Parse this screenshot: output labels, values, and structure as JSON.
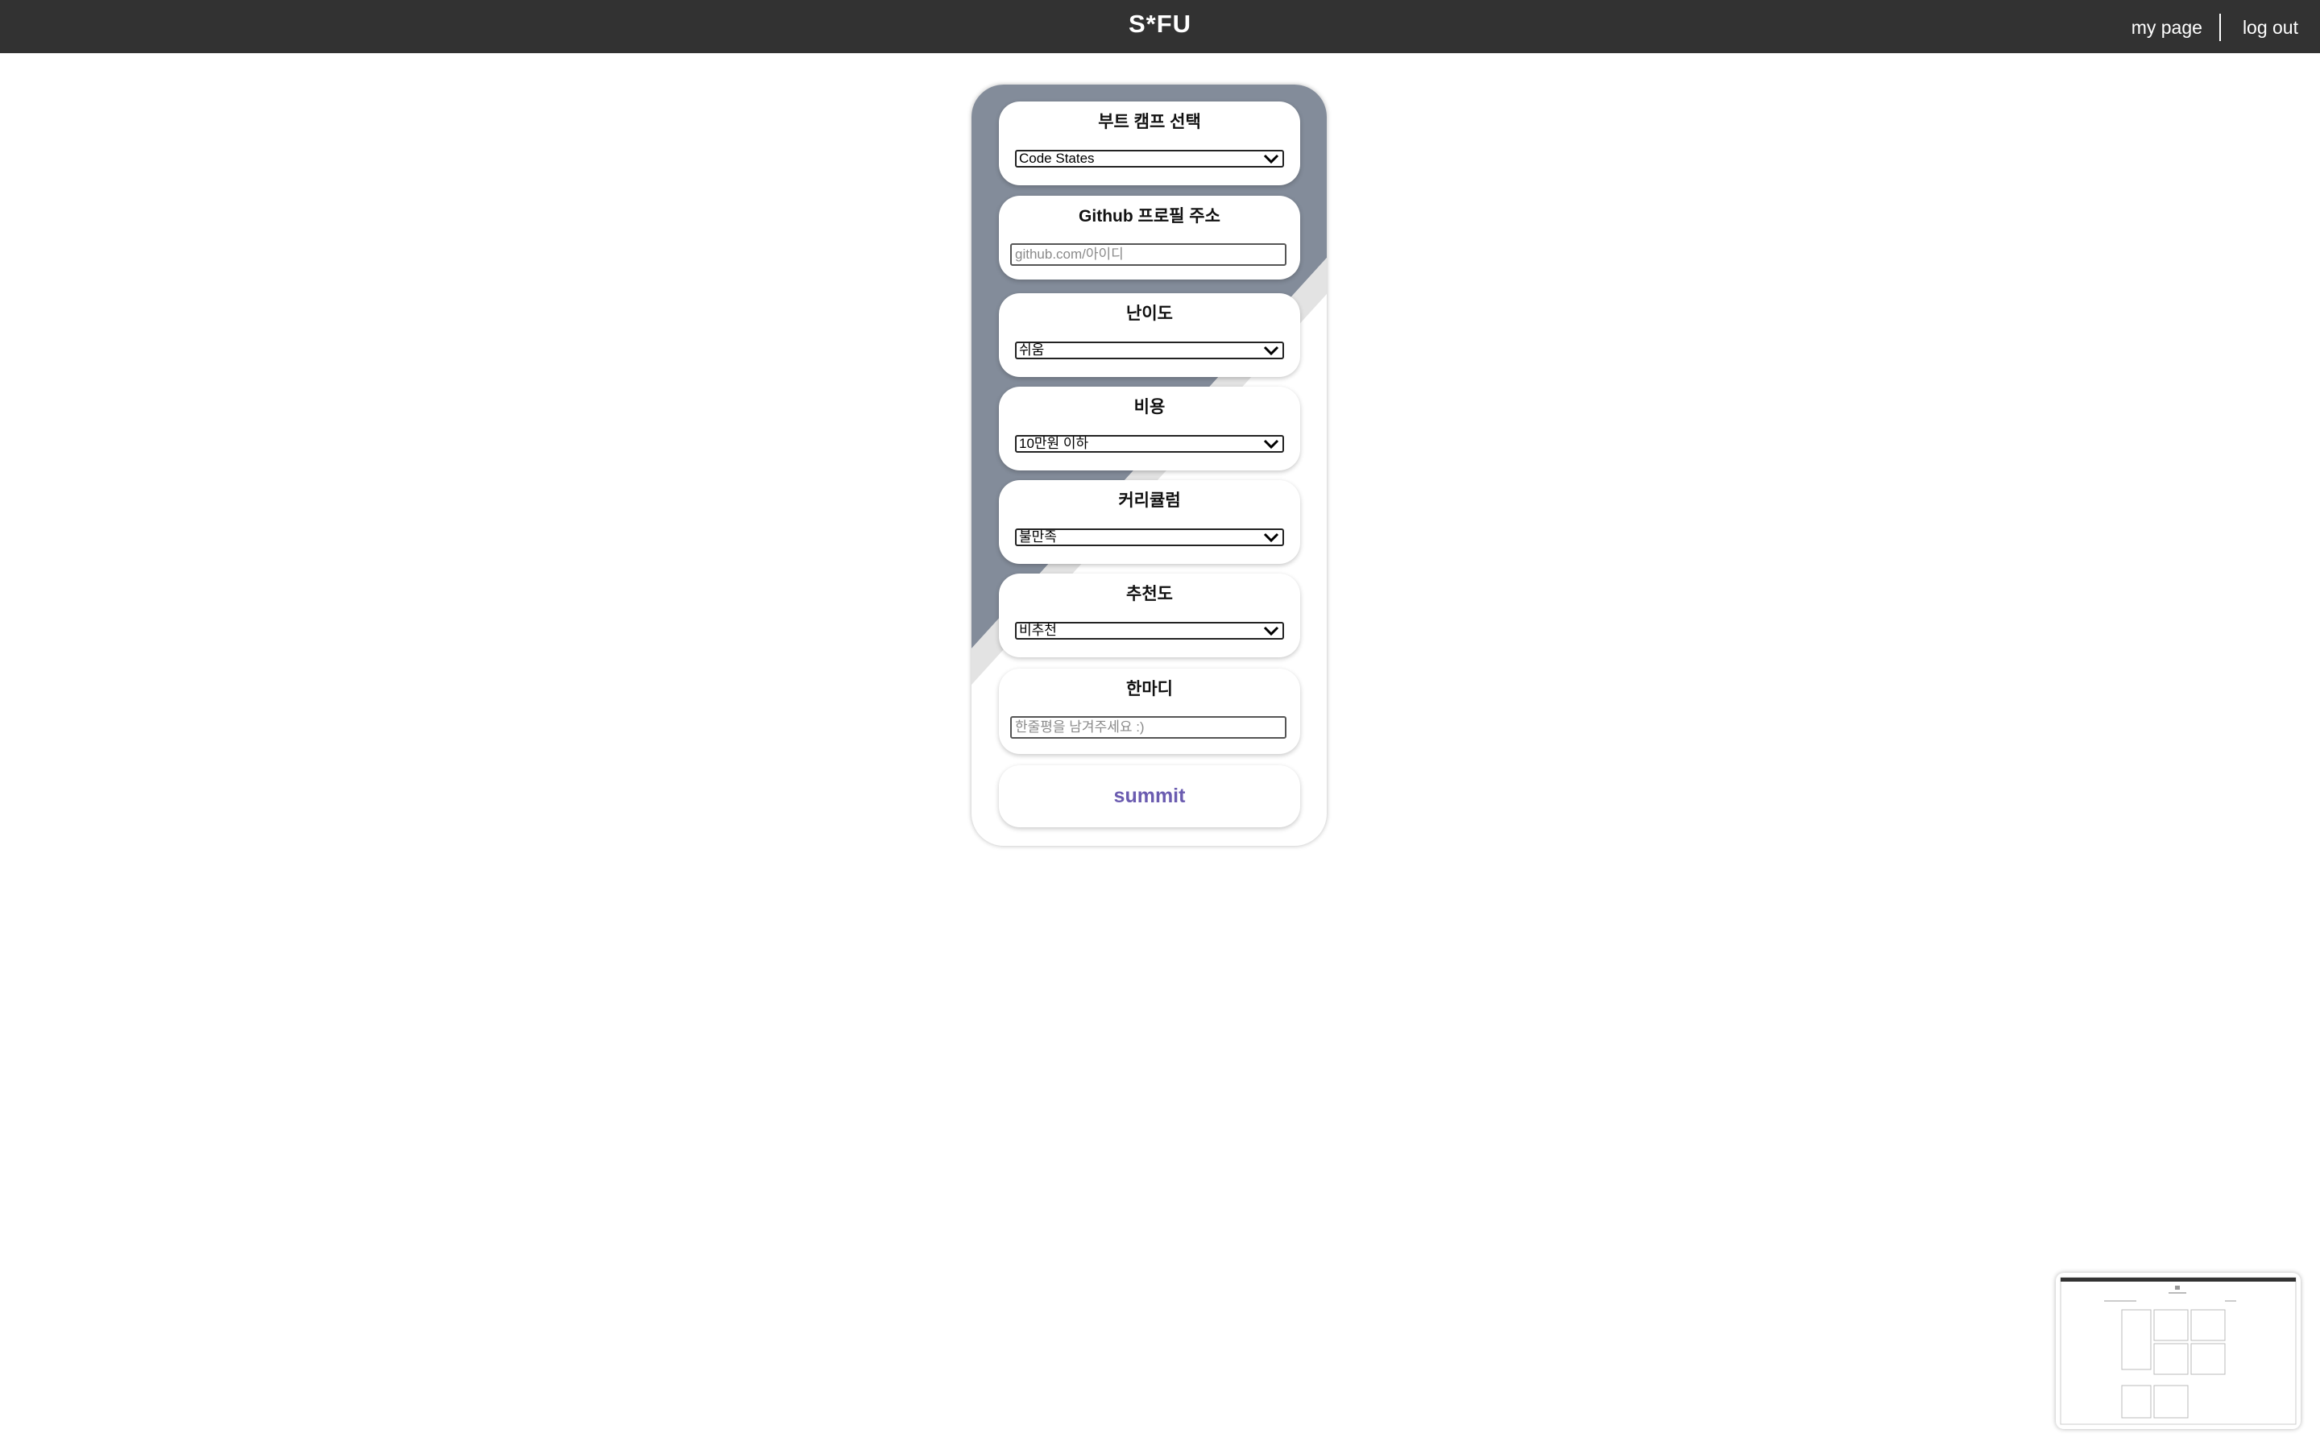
{
  "header": {
    "brand": "S*FU",
    "nav": {
      "my_page": "my page",
      "log_out": "log out"
    }
  },
  "form": {
    "bootcamp": {
      "label": "부트 캠프 선택",
      "selected": "Code States"
    },
    "github": {
      "label": "Github 프로필 주소",
      "placeholder": "github.com/아이디",
      "value": ""
    },
    "difficulty": {
      "label": "난이도",
      "selected": "쉬움"
    },
    "cost": {
      "label": "비용",
      "selected": "10만원 이하"
    },
    "curriculum": {
      "label": "커리큘럼",
      "selected": "불만족"
    },
    "recommendation": {
      "label": "추천도",
      "selected": "비추천"
    },
    "comment": {
      "label": "한마디",
      "placeholder": "한줄평을 남겨주세요 :)",
      "value": ""
    },
    "submit_label": "summit"
  },
  "colors": {
    "header_bg": "#323232",
    "panel_accent": "#838c9a",
    "submit_text": "#6b5cb0"
  },
  "icons": {
    "select_arrow": "chevron-down-icon"
  }
}
